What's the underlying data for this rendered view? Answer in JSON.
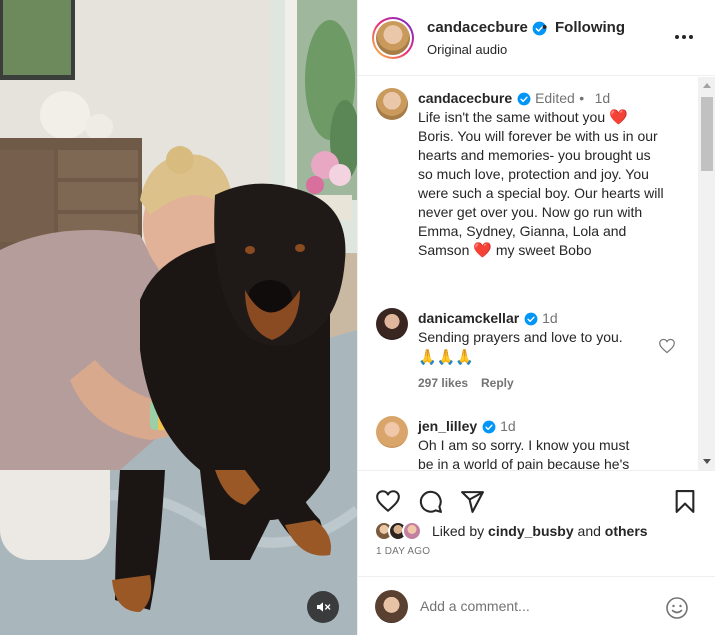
{
  "post": {
    "header": {
      "username": "candacecbure",
      "separator": "•",
      "follow_status": "Following",
      "audio": "Original audio",
      "more_icon": "more-horizontal-icon"
    },
    "caption": {
      "username": "candacecbure",
      "edited": "Edited",
      "dot": "•",
      "age": "1d",
      "text_before_heart": "Life isn't the same without you",
      "lines": [
        "Boris. You will forever be with us in our",
        "hearts and memories- you brought us",
        "so much love, protection and joy. You",
        "were such a special boy. Our hearts will",
        "never get over you. Now go run with",
        "Emma, Sydney, Gianna, Lola and"
      ],
      "last_line_start": "Samson",
      "last_line_end": "my sweet Bobo",
      "heart_emoji": "❤️"
    },
    "comments": [
      {
        "username": "danicamckellar",
        "age": "1d",
        "text": "Sending prayers and love to you.",
        "emoji": "🙏🙏🙏",
        "likes": "297 likes",
        "reply": "Reply"
      },
      {
        "username": "jen_lilley",
        "age": "1d",
        "lines": [
          "Oh I am so sorry. I know you must",
          "be in a world of pain because he's"
        ]
      }
    ],
    "liked_by": {
      "prefix": "Liked by",
      "user": "cindy_busby",
      "and": "and",
      "others": "others"
    },
    "time_ago": "1 DAY AGO",
    "add_comment_placeholder": "Add a comment..."
  },
  "colors": {
    "verified": "#0095f6",
    "heart": "#e0245e",
    "muted_text": "#737373",
    "primary_text": "#262626"
  }
}
